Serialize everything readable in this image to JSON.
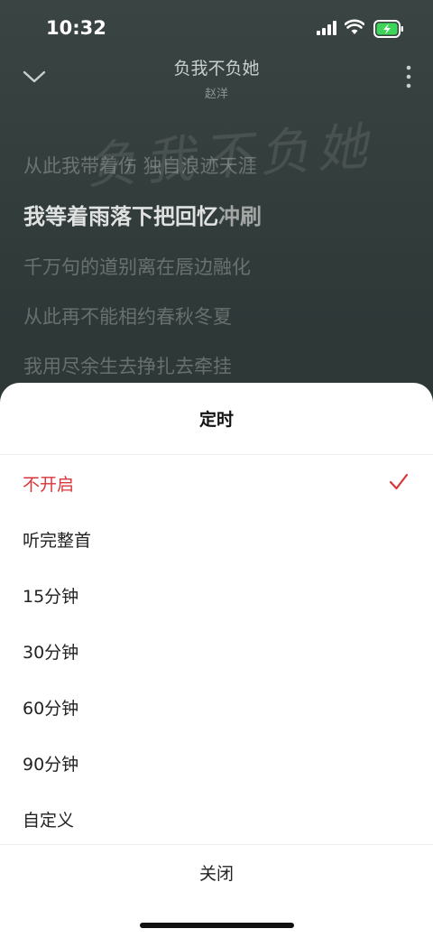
{
  "status_bar": {
    "time": "10:32"
  },
  "player": {
    "song_title": "负我不负她",
    "artist": "赵洋",
    "calligraphy": "负我不负她",
    "lyrics": [
      "从此我带着伤 独自浪迹天涯",
      "千万句的道别离在唇边融化",
      "从此再不能相约春秋冬夏",
      "我用尽余生去挣扎去牵挂"
    ],
    "current_lyric": {
      "highlighted": "我等着雨落下把回忆",
      "rest": "冲刷"
    }
  },
  "timer_sheet": {
    "title": "定时",
    "options": [
      {
        "label": "不开启",
        "selected": true
      },
      {
        "label": "听完整首",
        "selected": false
      },
      {
        "label": "15分钟",
        "selected": false
      },
      {
        "label": "30分钟",
        "selected": false
      },
      {
        "label": "60分钟",
        "selected": false
      },
      {
        "label": "90分钟",
        "selected": false
      },
      {
        "label": "自定义",
        "selected": false
      }
    ],
    "close_label": "关闭"
  },
  "colors": {
    "accent": "#d8353a",
    "battery": "#3ed45a"
  }
}
